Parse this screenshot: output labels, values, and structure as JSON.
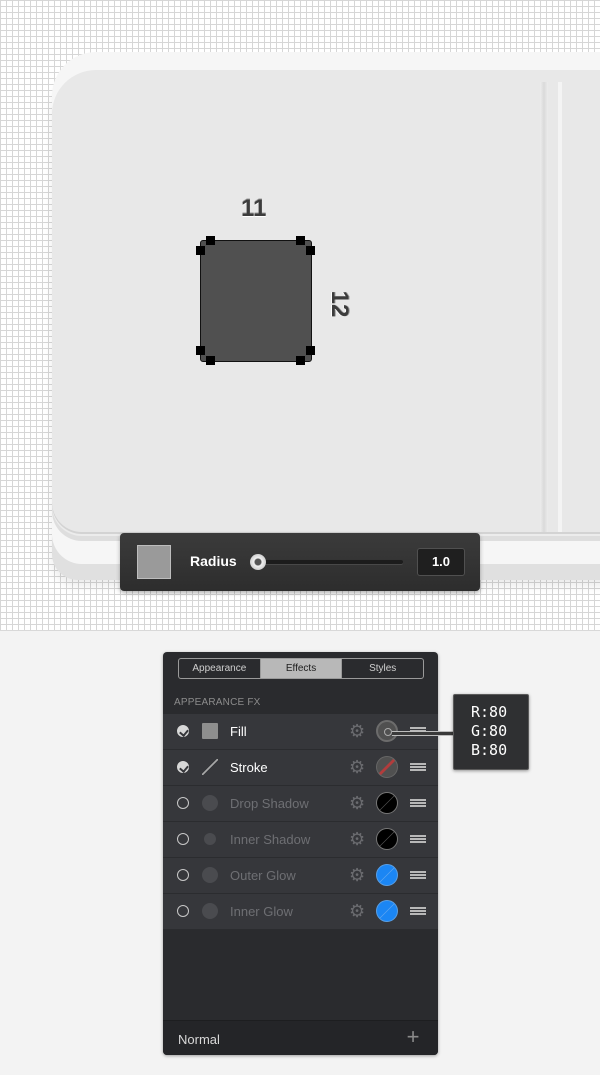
{
  "canvas": {
    "width_dimension": "11",
    "height_dimension": "12",
    "shape_fill_color": "#505050"
  },
  "radius_bar": {
    "swatch_color": "#9a9a9a",
    "label": "Radius",
    "slider_fraction": 0.0,
    "value": "1.0"
  },
  "panel": {
    "tabs": [
      {
        "label": "Appearance",
        "active": false
      },
      {
        "label": "Effects",
        "active": true
      },
      {
        "label": "Styles",
        "active": false
      }
    ],
    "section_title": "APPEARANCE FX",
    "rows": [
      {
        "label": "Fill",
        "enabled": true,
        "icon": "fill-square-icon",
        "swatch": "#505050"
      },
      {
        "label": "Stroke",
        "enabled": true,
        "icon": "stroke-line-icon",
        "swatch": "#505050"
      },
      {
        "label": "Drop Shadow",
        "enabled": false,
        "icon": "dot-icon",
        "swatch": "#000000"
      },
      {
        "label": "Inner Shadow",
        "enabled": false,
        "icon": "dot-icon",
        "swatch": "#000000"
      },
      {
        "label": "Outer Glow",
        "enabled": false,
        "icon": "dot-icon",
        "swatch": "#1b86f4"
      },
      {
        "label": "Inner Glow",
        "enabled": false,
        "icon": "dot-icon",
        "swatch": "#1b86f4"
      }
    ],
    "blend_mode": "Normal",
    "add_icon": "plus-icon"
  },
  "tooltip": {
    "r": "R:80",
    "g": "G:80",
    "b": "B:80"
  }
}
